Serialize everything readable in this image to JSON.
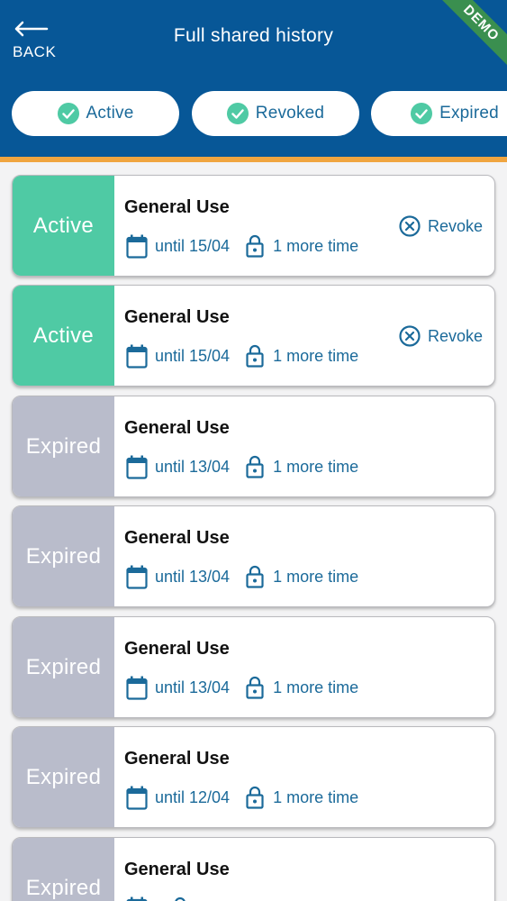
{
  "header": {
    "back_label": "BACK",
    "title": "Full shared history",
    "demo_badge": "DEMO",
    "background_color": "#075797",
    "accent_bar_color": "#f0a540",
    "demo_badge_color": "#3a8f4f"
  },
  "filters": [
    {
      "label": "Active",
      "checked": true,
      "icon": "check-circle-icon"
    },
    {
      "label": "Revoked",
      "checked": true,
      "icon": "check-circle-icon"
    },
    {
      "label": "Expired",
      "checked": true,
      "icon": "check-circle-icon"
    }
  ],
  "colors": {
    "active_status": "#4fcaa4",
    "expired_status": "#b9bccb",
    "link": "#1b6a9a",
    "check": "#4fcaa4"
  },
  "shares": [
    {
      "status": "Active",
      "purpose": "General Use",
      "until": "until 15/04",
      "uses": "1 more time",
      "action": "Revoke"
    },
    {
      "status": "Active",
      "purpose": "General Use",
      "until": "until 15/04",
      "uses": "1 more time",
      "action": "Revoke"
    },
    {
      "status": "Expired",
      "purpose": "General Use",
      "until": "until 13/04",
      "uses": "1 more time"
    },
    {
      "status": "Expired",
      "purpose": "General Use",
      "until": "until 13/04",
      "uses": "1 more time"
    },
    {
      "status": "Expired",
      "purpose": "General Use",
      "until": "until 13/04",
      "uses": "1 more time"
    },
    {
      "status": "Expired",
      "purpose": "General Use",
      "until": "until 12/04",
      "uses": "1 more time"
    },
    {
      "status": "Expired",
      "purpose": "General Use",
      "until": "",
      "uses": ""
    }
  ]
}
